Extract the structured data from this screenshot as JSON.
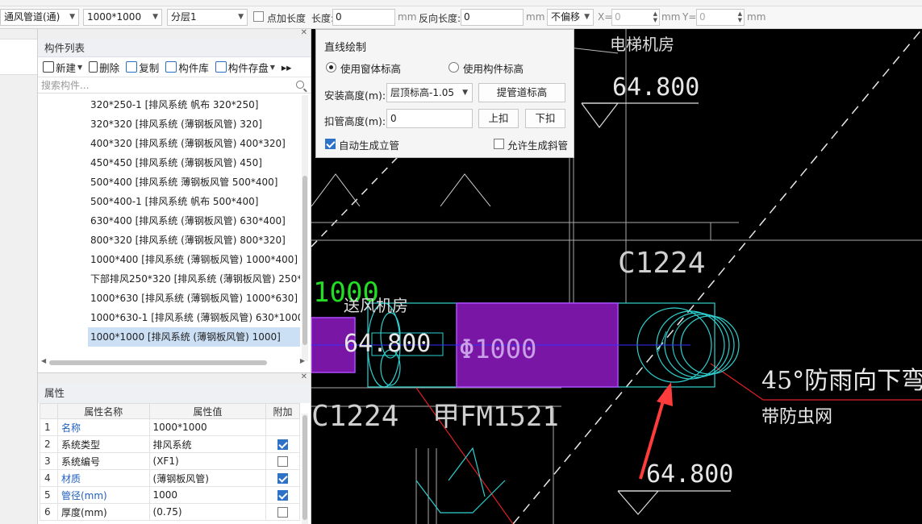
{
  "toolbar": {
    "type_select": "通风管道(通)",
    "size_select": "1000*1000",
    "layer_select": "分层1",
    "point_length_label": "点加长度",
    "length_label": "长度:",
    "length_value": "0",
    "unit_mm": "mm",
    "reverse_length_label": "反向长度:",
    "reverse_length_value": "0",
    "offset_select": "不偏移",
    "x_label": "X=",
    "x_value": "0",
    "y_label": "Y=",
    "y_value": "0"
  },
  "component_panel": {
    "title": "构件列表",
    "tools": {
      "new": "新建",
      "delete": "删除",
      "copy": "复制",
      "library": "构件库",
      "save": "构件存盘"
    },
    "search_placeholder": "搜索构件...",
    "items": [
      "320*250-1 [排风系统 帆布 320*250]",
      "320*320 [排风系统 (薄钢板风管) 320]",
      "400*320 [排风系统 (薄钢板风管) 400*320]",
      "450*450 [排风系统 (薄钢板风管) 450]",
      "500*400 [排风系统 薄钢板风管 500*400]",
      "500*400-1 [排风系统 帆布 500*400]",
      "630*400 [排风系统 (薄钢板风管) 630*400]",
      "800*320 [排风系统 (薄钢板风管) 800*320]",
      "1000*400 [排风系统 (薄钢板风管) 1000*400]",
      "下部排风250*320 [排风系统 (薄钢板风管) 250*3",
      "1000*630 [排风系统 (薄钢板风管) 1000*630]",
      "1000*630-1 [排风系统 (薄钢板风管) 630*1000]",
      "1000*1000 [排风系统 (薄钢板风管) 1000]"
    ]
  },
  "properties": {
    "title": "属性",
    "headers": [
      "属性名称",
      "属性值",
      "附加"
    ],
    "rows": [
      {
        "num": "1",
        "name": "名称",
        "value": "1000*1000",
        "checked": false,
        "blue": true,
        "has_check": false
      },
      {
        "num": "2",
        "name": "系统类型",
        "value": "排风系统",
        "checked": true,
        "blue": false,
        "has_check": true
      },
      {
        "num": "3",
        "name": "系统编号",
        "value": "(XF1)",
        "checked": false,
        "blue": false,
        "has_check": true
      },
      {
        "num": "4",
        "name": "材质",
        "value": "(薄钢板风管)",
        "checked": true,
        "blue": true,
        "has_check": true
      },
      {
        "num": "5",
        "name": "管径(mm)",
        "value": "1000",
        "checked": true,
        "blue": true,
        "has_check": true
      },
      {
        "num": "6",
        "name": "厚度(mm)",
        "value": "(0.75)",
        "checked": false,
        "blue": false,
        "has_check": true
      }
    ]
  },
  "dialog": {
    "title": "直线绘制",
    "radio_window": "使用窗体标高",
    "radio_component": "使用构件标高",
    "install_height_label": "安装高度(m):",
    "install_height_value": "层顶标高-1.05",
    "pipe_height_button": "提管道标高",
    "deduct_height_label": "扣管高度(m):",
    "deduct_height_value": "0",
    "up_button": "上扣",
    "down_button": "下扣",
    "auto_riser": "自动生成立管",
    "allow_slope": "允许生成斜管"
  },
  "cad": {
    "elev_top": "64.800",
    "elev_mid": "64.800",
    "elev_bottom": "64.800",
    "label_elevator_room": "电梯机房",
    "label_supply_room": "送风机房",
    "label_c1224_right": "C1224",
    "label_c1224_left": "C1224",
    "label_fm": "甲FM1521",
    "label_1000": "1000",
    "label_phi": "Φ1000",
    "note_line1": "45°防雨向下弯",
    "note_line2": "带防虫网",
    "colors": {
      "duct_fill": "#7a16a6",
      "duct_stroke": "#b04bff",
      "cyan": "#2ed0d0",
      "annotation": "#e0e0e0",
      "green": "#22dd22",
      "red": "#e02020",
      "arrow": "#ff3b3b"
    }
  }
}
